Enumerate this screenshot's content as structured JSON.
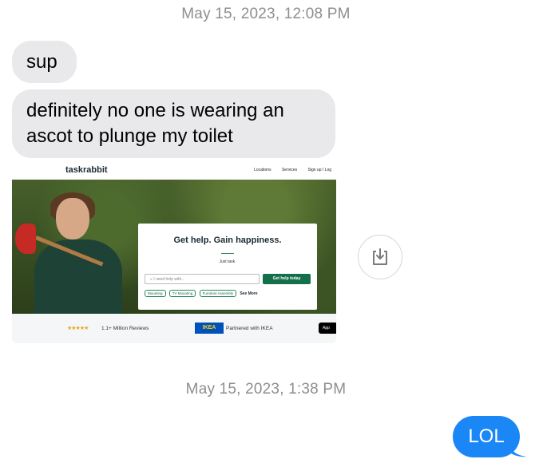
{
  "timestamps": [
    "May 15, 2023, 12:08 PM",
    "May 15, 2023, 1:38 PM"
  ],
  "messages": {
    "received": [
      "sup",
      "definitely no one is wearing an ascot to plunge my toilet"
    ],
    "sent": [
      "LOL"
    ]
  },
  "attachment": {
    "logo": "taskrabbit",
    "nav": [
      "Locations",
      "Services",
      "Sign up / Log"
    ],
    "headline": "Get help. Gain happiness.",
    "subhead": "Just task.",
    "search_placeholder": "I need help with...",
    "cta": "Get help today",
    "chips": [
      "Mounting",
      "TV Mounting",
      "Furniture Assembly"
    ],
    "see_more": "See More",
    "stars": "★★★★★",
    "reviews": "1.1+ Million Reviews",
    "ikea_logo": "IKEA",
    "partner": "Partnered with IKEA",
    "appstore": "App"
  },
  "icons": {
    "save": "download-to-tray-icon"
  },
  "colors": {
    "sent_bubble": "#1b87f7",
    "received_bubble": "#e9e9eb",
    "timestamp": "#8e8e93"
  }
}
